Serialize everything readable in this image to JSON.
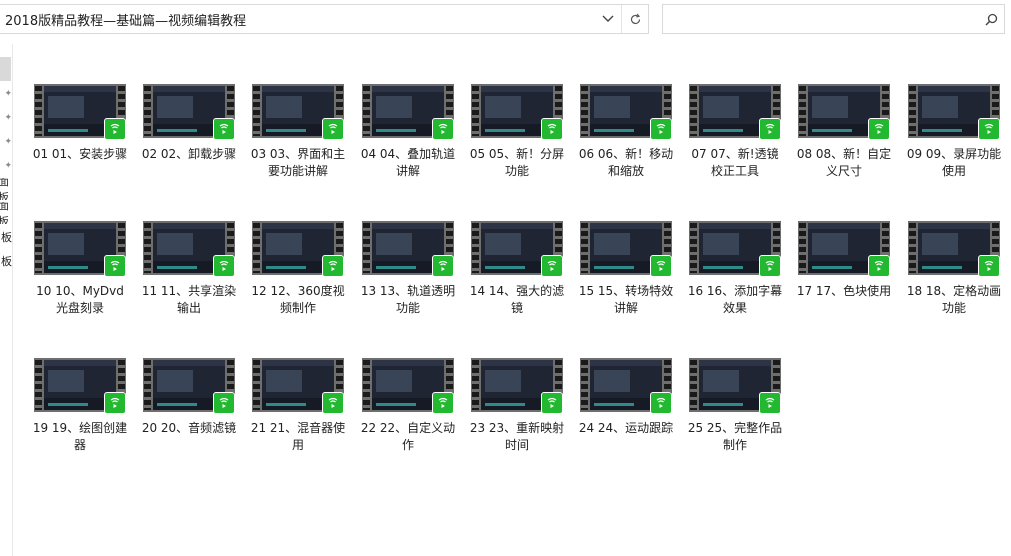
{
  "address": {
    "path": "2018版精品教程—基础篇—视频编辑教程"
  },
  "search": {
    "placeholder": ""
  },
  "nav": {
    "items": [
      "面板",
      "面板",
      "板",
      "板"
    ]
  },
  "files": [
    "01 01、安装步骤",
    "02 02、卸载步骤",
    "03 03、界面和主要功能讲解",
    "04 04、叠加轨道讲解",
    "05 05、新！分屏功能",
    "06 06、新！移动和缩放",
    "07 07、新!透镜校正工具",
    "08 08、新！自定义尺寸",
    "09 09、录屏功能使用",
    "10 10、MyDvd光盘刻录",
    "11 11、共享渲染输出",
    "12 12、360度视频制作",
    "13 13、轨道透明功能",
    "14 14、强大的滤镜",
    "15 15、转场特效讲解",
    "16 16、添加字幕效果",
    "17 17、色块使用",
    "18 18、定格动画功能",
    "19 19、绘图创建器",
    "20 20、音频滤镜",
    "21 21、混音器使用",
    "22 22、自定义动作",
    "23 23、重新映射时间",
    "24 24、运动跟踪",
    "25 25、完整作品制作"
  ],
  "colors": {
    "badge": "#22b82f",
    "film": "#6e6e6e"
  }
}
